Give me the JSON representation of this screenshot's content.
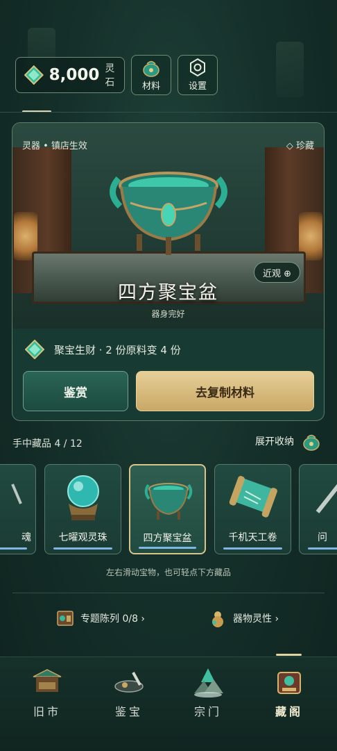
{
  "topbar": {
    "currency": {
      "icon": "jade-gem-icon",
      "amount": "8,000",
      "unit": "灵石"
    },
    "materials_label": "材料",
    "settings_label": "设置"
  },
  "showcase": {
    "tag_left": "灵器 • 镇店生效",
    "tag_right": "◇ 珍藏",
    "zoom_label": "近观 ⊕",
    "item_name": "四方聚宝盆",
    "item_state": "器身完好",
    "effect_text": "聚宝生财 · 2 份原料变 4 份",
    "appraise_label": "鉴赏",
    "copy_label": "去复制材料"
  },
  "collection": {
    "count_label": "手中藏品 4 / 12",
    "toggle_label": "展开收纳",
    "items": [
      {
        "name": "魂",
        "icon": "sword-icon"
      },
      {
        "name": "七曜观灵珠",
        "icon": "spirit-orb-icon"
      },
      {
        "name": "四方聚宝盆",
        "icon": "cauldron-icon"
      },
      {
        "name": "千机天工卷",
        "icon": "scroll-icon"
      },
      {
        "name": "问",
        "icon": "blade-icon"
      }
    ],
    "hint": "左右滑动宝物，也可轻点下方藏品"
  },
  "links": {
    "exhibit": "专题陈列 0/8 ›",
    "spirit": "器物灵性 ›"
  },
  "nav": {
    "items": [
      {
        "label": "旧市",
        "icon": "market-stall-icon"
      },
      {
        "label": "鉴宝",
        "icon": "appraisal-icon"
      },
      {
        "label": "宗门",
        "icon": "sect-mountain-icon"
      },
      {
        "label": "藏阁",
        "icon": "treasure-pavilion-icon"
      }
    ],
    "active": "藏阁"
  },
  "colors": {
    "accent_gold": "#e6cf98",
    "jade": "#2fbf9b",
    "background": "#15302a",
    "progress_blue": "#7fb6e3"
  }
}
